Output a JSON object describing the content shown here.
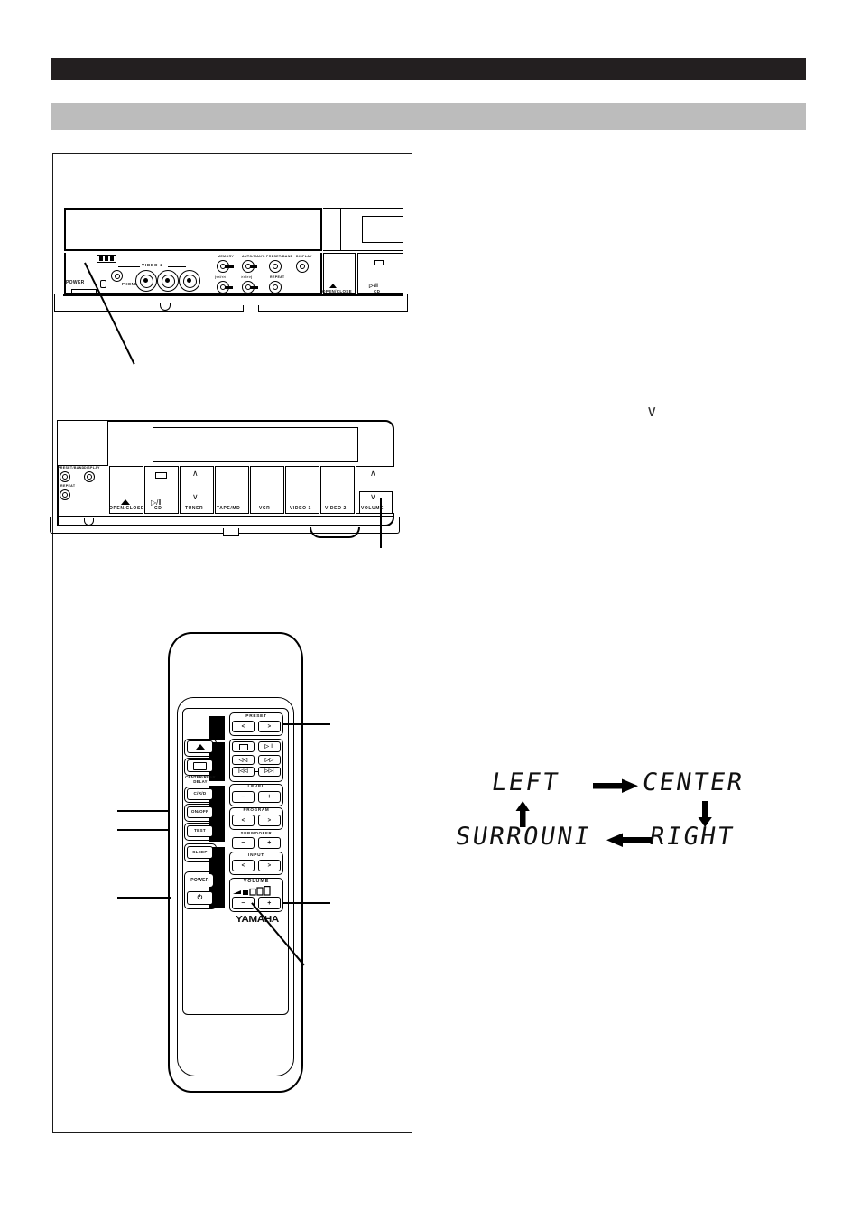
{
  "header": {
    "black_bar_color": "#231f20",
    "gray_bar_color": "#bcbcbc"
  },
  "front_panel_top": {
    "name": "receiver-front-panel-upper",
    "power_label": "POWER",
    "phones_label": "PHONES",
    "video2_label": "VIDEO 2",
    "tuner_controls": [
      "MEMORY",
      "AUTO/MAN'L",
      "PRESET/BAND",
      "DISPLAY"
    ],
    "disc_controls": [
      "|<</<<",
      ">>/>>|",
      "REPEAT"
    ],
    "open_close_label": "OPEN/CLOSE",
    "cd_label": "CD",
    "cd_symbol": "▷/‖"
  },
  "front_panel_bottom": {
    "name": "receiver-front-panel-lower",
    "left_knobs": [
      "PRESET/BAND",
      "DISPLAY",
      "REPEAT"
    ],
    "keys": [
      {
        "label": "OPEN/CLOSE",
        "icon": "eject-icon"
      },
      {
        "label": "CD",
        "icon": "play-pause-icon"
      },
      {
        "label": "TUNER",
        "icon": "up-down-chevrons"
      },
      {
        "label": "TAPE/MD",
        "icon": ""
      },
      {
        "label": "VCR",
        "icon": ""
      },
      {
        "label": "VIDEO 1",
        "icon": ""
      },
      {
        "label": "VIDEO 2",
        "icon": ""
      },
      {
        "label": "VOLUME",
        "icon": "up-down-chevrons"
      }
    ]
  },
  "remote": {
    "name": "remote-control",
    "brand": "YAMAHA",
    "groups": {
      "preset": {
        "label": "PRESET",
        "left": "<",
        "right": ">"
      },
      "transport": {
        "stop": "□",
        "play_pause": "▷ ‖",
        "rew": "◁◁",
        "ffwd": "▷▷",
        "prev": "|◁◁",
        "next": "▷▷|"
      },
      "level": {
        "label": "LEVEL",
        "minus": "−",
        "plus": "+"
      },
      "program": {
        "label": "PROGRAM",
        "left": "<",
        "right": ">"
      },
      "subwoofer": {
        "label": "SUBWOOFER",
        "minus": "−",
        "plus": "+"
      },
      "input": {
        "label": "INPUT",
        "left": "<",
        "right": ">"
      },
      "volume": {
        "label": "VOLUME",
        "minus": "−",
        "plus": "+"
      }
    },
    "left_buttons": [
      {
        "label": "",
        "icon": "eject-icon",
        "name": "eject-button"
      },
      {
        "label": "",
        "icon": "disc-tray-icon",
        "name": "disc-tray-button"
      },
      {
        "label": "CENTER/REAR\nDELAY",
        "icon": "",
        "name": "center-rear-delay-label"
      },
      {
        "label": "C/R/D",
        "icon": "",
        "name": "crd-button"
      },
      {
        "label": "ON/OFF",
        "icon": "",
        "name": "on-off-button"
      },
      {
        "label": "TEST",
        "icon": "",
        "name": "test-button"
      },
      {
        "label": "SLEEP",
        "icon": "",
        "name": "sleep-button"
      },
      {
        "label": "POWER",
        "icon": "",
        "name": "power-label-button"
      },
      {
        "label": "",
        "icon": "standby-power-icon",
        "name": "standby-button"
      }
    ],
    "center_rear_delay_line1": "CENTER/REAR",
    "center_rear_delay_line2": "DELAY",
    "standby_glyph": "⏻"
  },
  "segment_diagram": {
    "name": "speaker-channel-cycle",
    "nodes": [
      "LEFT",
      "CENTER",
      "RIGHT",
      "SURROUND"
    ],
    "labels": {
      "top_left": "LEFT",
      "top_right": "CENTER",
      "bottom_right": "RIGHT",
      "bottom_left": "SURROUNI"
    },
    "flow": "LEFT → CENTER ↓ RIGHT ← SURROUND ↑ LEFT"
  },
  "misc": {
    "chevron_glyph": "∨"
  }
}
